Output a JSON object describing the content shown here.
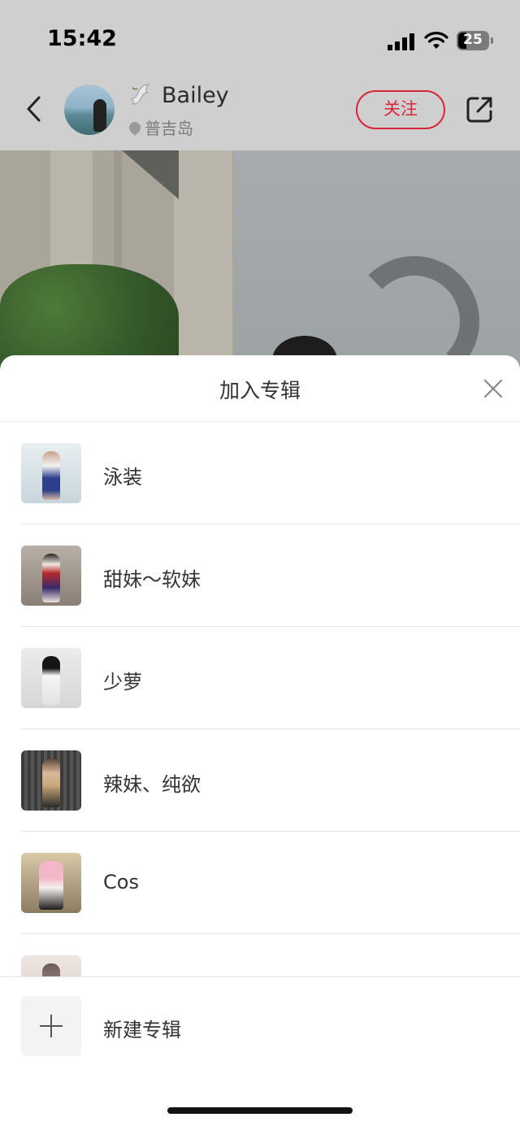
{
  "status_bar": {
    "time": "15:42",
    "battery": "25"
  },
  "header": {
    "username": "Bailey",
    "location": "普吉岛",
    "follow_label": "关注",
    "accent_color": "#d8263a"
  },
  "sheet": {
    "title": "加入专辑",
    "albums": [
      {
        "label": "泳装"
      },
      {
        "label": "甜妹～软妹"
      },
      {
        "label": "少萝"
      },
      {
        "label": "辣妹、纯欲"
      },
      {
        "label": "Cos"
      },
      {
        "label": ""
      }
    ],
    "new_album_label": "新建专辑"
  }
}
